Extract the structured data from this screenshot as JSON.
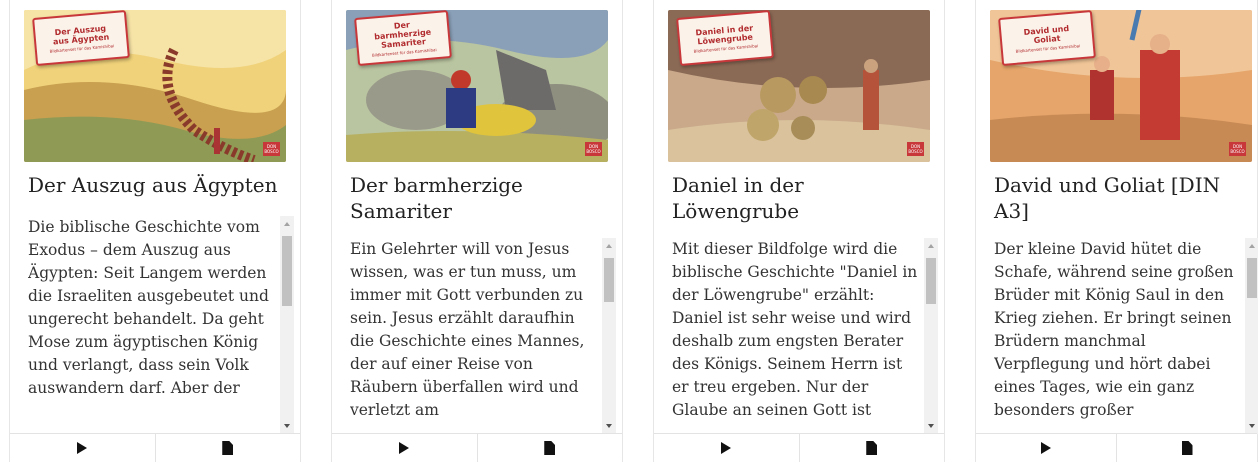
{
  "cards": [
    {
      "label_title": "Der Auszug aus Ägypten",
      "label_sub": "Bildkartenset für das Kamishibai",
      "badge": "DON BOSCO",
      "title": "Der Auszug aus Ägypten",
      "description": "Die biblische Geschichte vom Exodus – dem Auszug aus Ägypten: Seit Langem werden die Israeliten ausgebeutet und ungerecht behandelt. Da geht Mose zum ägyptischen König und verlangt, dass sein Volk auswandern darf. Aber der",
      "play_icon": "play-icon",
      "doc_icon": "document-icon"
    },
    {
      "label_title": "Der barmherzige Samariter",
      "label_sub": "Bildkartenset für das Kamishibai",
      "badge": "DON BOSCO",
      "title": "Der barmherzige Samariter",
      "description": "Ein Gelehrter will von Jesus wissen, was er tun muss, um immer mit Gott verbunden zu sein. Jesus erzählt daraufhin die Geschichte eines Mannes, der auf einer Reise von Räubern überfallen wird und verletzt am",
      "play_icon": "play-icon",
      "doc_icon": "document-icon"
    },
    {
      "label_title": "Daniel in der Löwengrube",
      "label_sub": "Bildkartenset für das Kamishibai",
      "badge": "DON BOSCO",
      "title": "Daniel in der Löwengrube",
      "description": "Mit dieser Bildfolge wird die biblische Geschichte \"Daniel in der Löwengrube\" erzählt: Daniel ist sehr weise und wird deshalb zum engsten Berater des Königs. Seinem Herrn ist er treu ergeben. Nur der Glaube an seinen Gott ist",
      "play_icon": "play-icon",
      "doc_icon": "document-icon"
    },
    {
      "label_title": "David und Goliat",
      "label_sub": "Bildkartenset für das Kamishibai",
      "badge": "DON BOSCO",
      "title": "David und Goliat [DIN A3]",
      "description": "Der kleine David hütet die Schafe, während seine großen Brüder mit König Saul in den Krieg ziehen. Er bringt seinen Brüdern manchmal Verpflegung und hört dabei eines Tages, wie ein ganz besonders großer",
      "play_icon": "play-icon",
      "doc_icon": "document-icon"
    }
  ],
  "colors": {
    "label_red": "#c8383b",
    "text": "#333333"
  }
}
